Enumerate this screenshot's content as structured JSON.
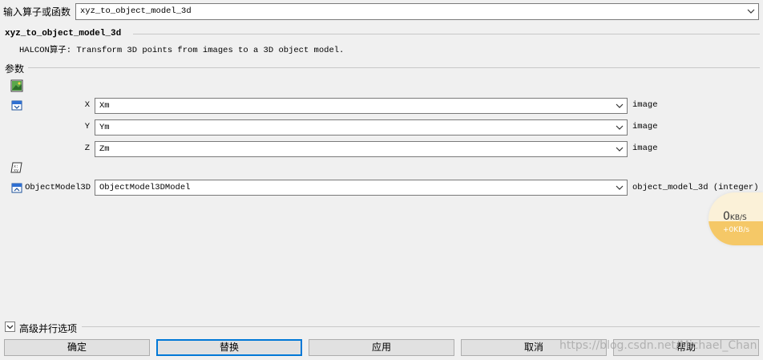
{
  "header": {
    "label": "输入算子或函数",
    "value": "xyz_to_object_model_3d"
  },
  "operator": {
    "name": "xyz_to_object_model_3d",
    "description": "HALCON算子: Transform 3D points from images to a 3D object model."
  },
  "params_section_label": "参数",
  "icons": {
    "section_image": "image-object-icon",
    "input_params": "input-parameter-icon",
    "control": "control-parameter-icon",
    "output": "output-parameter-icon"
  },
  "params": [
    {
      "name": "X",
      "value": "Xm",
      "type": "image"
    },
    {
      "name": "Y",
      "value": "Ym",
      "type": "image"
    },
    {
      "name": "Z",
      "value": "Zm",
      "type": "image"
    }
  ],
  "output_param": {
    "name": "ObjectModel3D",
    "value": "ObjectModel3DModel",
    "type": "object_model_3d (integer)"
  },
  "net_speed": {
    "down": "0",
    "down_unit": "KB/S",
    "up": "+0KB/s"
  },
  "advanced": {
    "label": "高级并行选项"
  },
  "buttons": {
    "ok": "确定",
    "replace": "替换",
    "apply": "应用",
    "cancel": "取消",
    "help": "帮助"
  },
  "watermark": "https://blog.csdn.net/Michael_Chan",
  "colors": {
    "accent": "#0078d7",
    "background": "#f0f0f0"
  }
}
